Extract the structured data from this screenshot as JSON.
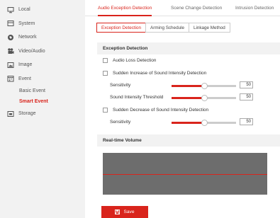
{
  "sidebar": {
    "items": [
      {
        "label": "Local",
        "icon": "monitor-icon"
      },
      {
        "label": "System",
        "icon": "system-icon"
      },
      {
        "label": "Network",
        "icon": "network-icon"
      },
      {
        "label": "Video/Audio",
        "icon": "video-audio-icon"
      },
      {
        "label": "Image",
        "icon": "image-icon"
      },
      {
        "label": "Event",
        "icon": "event-icon"
      }
    ],
    "event_sub": [
      {
        "label": "Basic Event",
        "active": false
      },
      {
        "label": "Smart Event",
        "active": true
      }
    ],
    "storage": {
      "label": "Storage",
      "icon": "storage-icon"
    }
  },
  "tabs": [
    "Audio Exception Detection",
    "Scene Change Detection",
    "Intrusion Detection"
  ],
  "subtabs": [
    "Exception Detection",
    "Arming Schedule",
    "Linkage Method"
  ],
  "exception": {
    "title": "Exception Detection",
    "audio_loss": "Audio Loss Detection",
    "increase": "Sudden Increase of Sound Intensity Detection",
    "decrease": "Sudden Decrease of Sound Intensity Detection"
  },
  "sliders": {
    "inc_sensitivity": {
      "label": "Sensitivity",
      "value": "50",
      "level": 0.5
    },
    "inc_threshold": {
      "label": "Sound Intensity Threshold",
      "value": "50",
      "level": 0.5
    },
    "dec_sensitivity": {
      "label": "Sensitivity",
      "value": "50",
      "level": 0.5
    }
  },
  "volume": {
    "title": "Real-time Volume"
  },
  "save_label": "Save",
  "colors": {
    "accent": "#d9241c",
    "sidebar_bg": "#f2f2f2",
    "volume_bg": "#6d6d6d"
  }
}
